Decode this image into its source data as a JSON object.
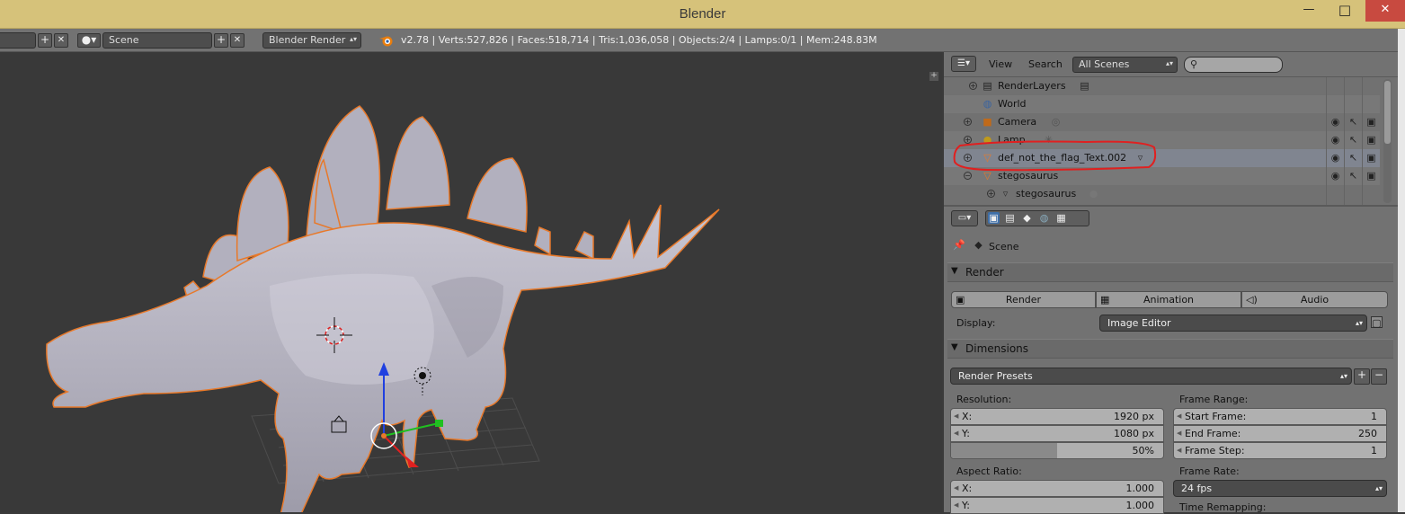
{
  "window": {
    "title": "Blender",
    "minimize": "—",
    "maximize": "□",
    "close": "✕"
  },
  "infobar": {
    "scene_name": "Scene",
    "render_engine": "Blender Render",
    "stats": "v2.78 | Verts:527,826 | Faces:518,714 | Tris:1,036,058 | Objects:2/4 | Lamps:0/1 | Mem:248.83M"
  },
  "outliner": {
    "menu_view": "View",
    "menu_search": "Search",
    "scene_filter": "All Scenes",
    "search_placeholder": "",
    "items": [
      {
        "label": "RenderLayers"
      },
      {
        "label": "World"
      },
      {
        "label": "Camera"
      },
      {
        "label": "Lamp"
      },
      {
        "label": "def_not_the_flag_Text.002"
      },
      {
        "label": "stegosaurus"
      },
      {
        "label": "stegosaurus"
      }
    ]
  },
  "properties": {
    "context": "Scene",
    "render_panel": {
      "title": "Render",
      "render_btn": "Render",
      "animation_btn": "Animation",
      "audio_btn": "Audio",
      "display_label": "Display:",
      "display_value": "Image Editor"
    },
    "dimensions_panel": {
      "title": "Dimensions",
      "presets": "Render Presets",
      "resolution_label": "Resolution:",
      "res_x_label": "X:",
      "res_x": "1920 px",
      "res_y_label": "Y:",
      "res_y": "1080 px",
      "res_pct": "50%",
      "res_pct_value": 0.5,
      "aspect_label": "Aspect Ratio:",
      "asp_x_label": "X:",
      "asp_x": "1.000",
      "asp_y_label": "Y:",
      "asp_y": "1.000",
      "frame_range_label": "Frame Range:",
      "start_label": "Start Frame:",
      "start": "1",
      "end_label": "End Frame:",
      "end": "250",
      "step_label": "Frame Step:",
      "step": "1",
      "frame_rate_label": "Frame Rate:",
      "frame_rate": "24 fps",
      "time_remap_label": "Time Remapping:"
    }
  },
  "colors": {
    "selection_outline": "#e8792a",
    "annotation": "#e02020",
    "title_bar": "#d6c27a"
  }
}
